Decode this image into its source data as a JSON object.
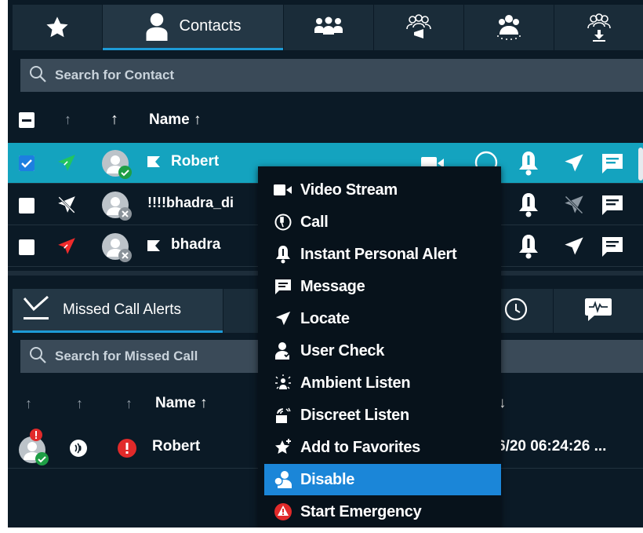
{
  "tabs": {
    "favorites_icon": "star-icon",
    "contacts_label": "Contacts",
    "groups_icon": "group-icon",
    "broadcast_icon": "broadcast-group-icon",
    "talkgroup_icon": "talkgroup-icon",
    "download_icon": "download-group-icon"
  },
  "contacts": {
    "search_placeholder": "Search for Contact",
    "header_name": "Name ↑",
    "rows": [
      {
        "name": "Robert",
        "selected": true,
        "checked": true,
        "location_color": "#22c55e"
      },
      {
        "name": "!!!!bhadra_di",
        "selected": false,
        "checked": false,
        "location_color": "#ffffff"
      },
      {
        "name": "bhadra",
        "selected": false,
        "checked": false,
        "location_color": "#ef2b2b"
      }
    ]
  },
  "bottom": {
    "tab_label": "Missed Call Alerts",
    "search_placeholder": "Search for Missed Call",
    "header_name": "Name ↑",
    "header_date_fragment": "e ↓",
    "rows": [
      {
        "name": "Robert",
        "date": "6/20 06:24:26 ..."
      }
    ]
  },
  "menu": {
    "items": [
      {
        "label": "Video Stream",
        "icon": "video-icon"
      },
      {
        "label": "Call",
        "icon": "call-icon"
      },
      {
        "label": "Instant Personal Alert",
        "icon": "bell-icon"
      },
      {
        "label": "Message",
        "icon": "message-icon"
      },
      {
        "label": "Locate",
        "icon": "locate-icon"
      },
      {
        "label": "User Check",
        "icon": "user-check-icon"
      },
      {
        "label": "Ambient Listen",
        "icon": "ambient-listen-icon"
      },
      {
        "label": "Discreet Listen",
        "icon": "discreet-listen-icon"
      },
      {
        "label": "Add to Favorites",
        "icon": "star-add-icon"
      },
      {
        "label": "Disable",
        "icon": "disable-user-icon"
      },
      {
        "label": "Start Emergency",
        "icon": "emergency-icon"
      }
    ],
    "highlighted_index": 9
  },
  "colors": {
    "background": "#0b1a26",
    "selected_row": "#14a3bf",
    "menu_highlight": "#1b86d8",
    "accent": "#1d9bd7",
    "emergency_red": "#e12a2a"
  }
}
